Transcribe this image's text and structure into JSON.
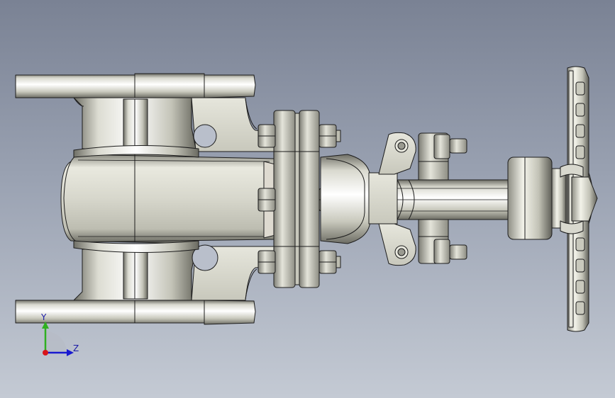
{
  "model": {
    "part": "gate-valve",
    "view": "front-orthographic",
    "colors": {
      "metal_light": "#f4f4ec",
      "metal_mid": "#c9c9bd",
      "metal_dark": "#6d6d64",
      "edge": "#1c1c1c",
      "background_top": "#7a8294",
      "background_bottom": "#c4cad4"
    }
  },
  "triad": {
    "y_label": "Y",
    "z_label": "Z",
    "x_color": "#d8141a",
    "y_color": "#2fb020",
    "z_color": "#1a1ad0"
  }
}
